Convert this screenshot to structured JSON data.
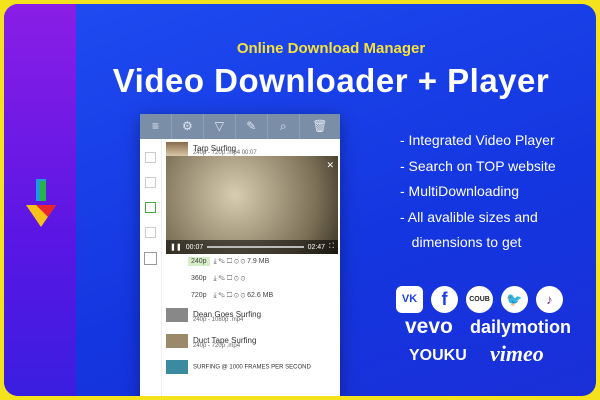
{
  "header": {
    "subtitle": "Online Download Manager",
    "title": "Video Downloader + Player"
  },
  "app": {
    "toolbar": [
      "≡",
      "⚙",
      "▽",
      "✎",
      "⌕",
      "🗑"
    ],
    "items": [
      {
        "title": "Tarp Surfing",
        "meta": "240p - 720p   .mp4   00:07"
      },
      {
        "title": "Dean Goes Surfing",
        "meta": "240p - 1080p   .mp4"
      },
      {
        "title": "Duct Tape Surfing",
        "meta": "240p - 720p   .mp4"
      },
      {
        "title": "SURFING @ 1000 FRAMES PER SECOND"
      }
    ],
    "player": {
      "current": "00:07",
      "duration": "02:47"
    },
    "qualities": [
      {
        "label": "240p",
        "size": "7.9 MB"
      },
      {
        "label": "360p",
        "size": ""
      },
      {
        "label": "720p",
        "size": "62.6 MB"
      }
    ]
  },
  "features": [
    "- Integrated Video Player",
    "- Search on TOP website",
    "- MultiDownloading",
    "- All avalible sizes and",
    "   dimensions to get"
  ],
  "social": [
    "VK",
    "f",
    "COUB",
    "🐦",
    "♪"
  ],
  "brands": {
    "vevo": "vevo",
    "dailymotion": "dailymotion",
    "youku": "YOUKU",
    "vimeo": "vimeo"
  }
}
